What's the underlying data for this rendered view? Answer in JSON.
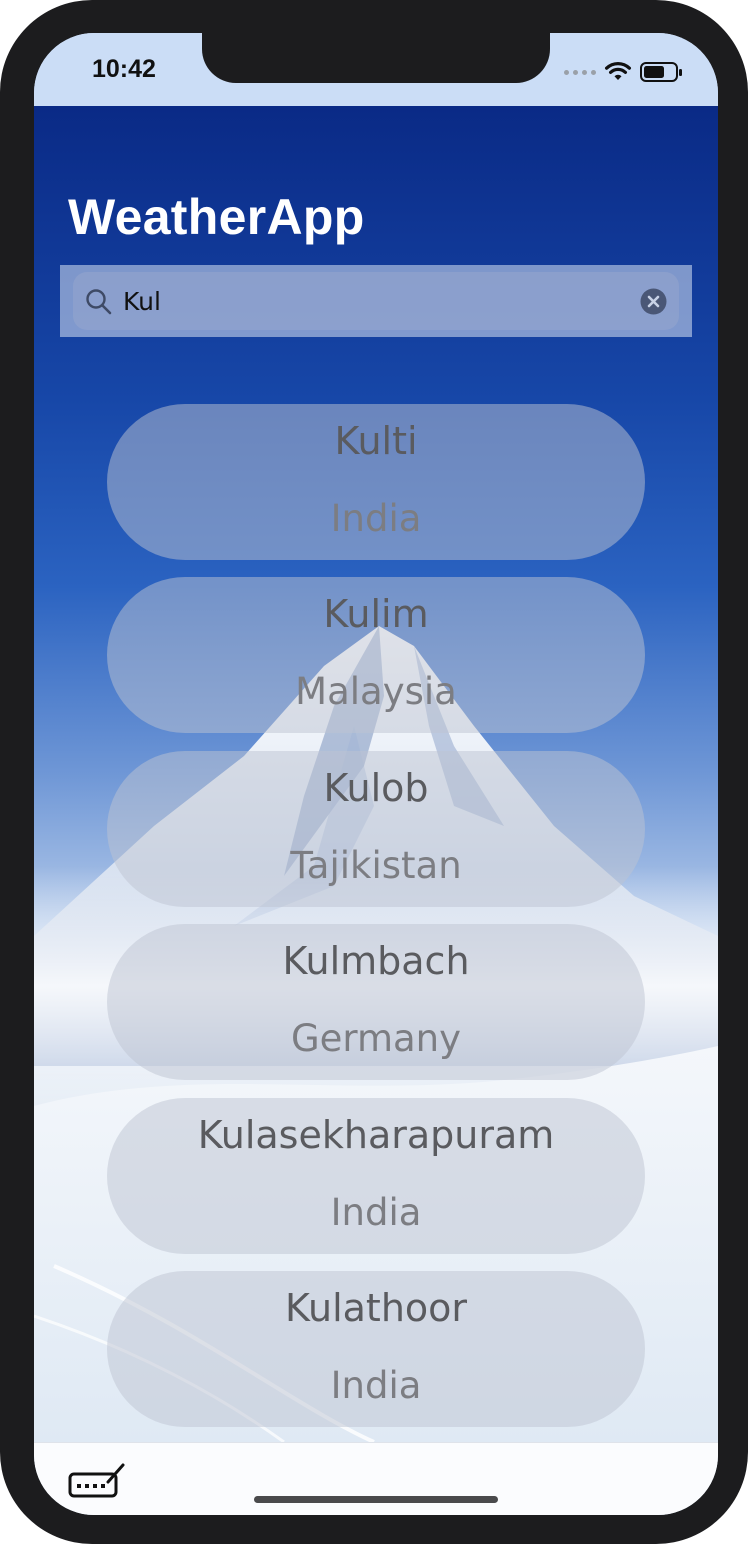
{
  "status_bar": {
    "time": "10:42"
  },
  "app": {
    "title": "WeatherApp"
  },
  "search": {
    "value": "Kul",
    "placeholder": ""
  },
  "results": [
    {
      "city": "Kulti",
      "country": "India"
    },
    {
      "city": "Kulim",
      "country": "Malaysia"
    },
    {
      "city": "Kulob",
      "country": "Tajikistan"
    },
    {
      "city": "Kulmbach",
      "country": "Germany"
    },
    {
      "city": "Kulasekharapuram",
      "country": "India"
    },
    {
      "city": "Kulathoor",
      "country": "India"
    }
  ],
  "icons": {
    "search": "magnifier",
    "clear": "x-circle-filled",
    "keyboard": "keyboard-with-pencil",
    "signal": "cellular-dots",
    "wifi": "wifi",
    "battery": "battery-half"
  },
  "colors": {
    "title_text": "#ffffff",
    "card_city_text": "#5a5b5f",
    "card_country_text": "#7c7d82",
    "status_bar_bg": "#cbddf6"
  }
}
